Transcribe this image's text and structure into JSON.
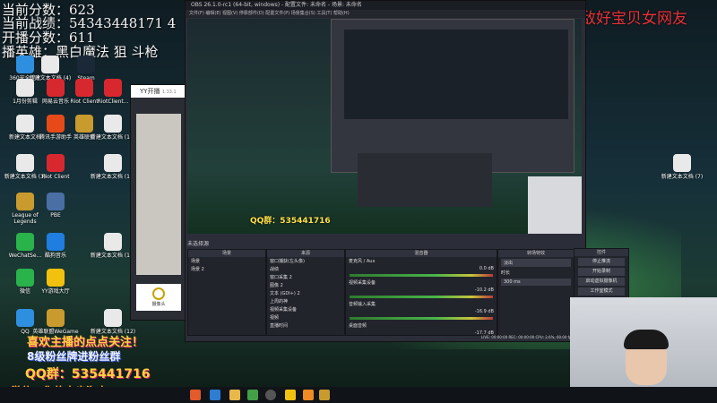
{
  "overlay": {
    "line1": "当前分数：623",
    "line2": "当前战绩：54343448171 4",
    "line3": "开播分数：611",
    "line4": "播英雄：黑白魔法 狙 斗枪"
  },
  "stream_title": "上周的神：宇宙无敌好宝贝女网友",
  "desktop_icons": [
    {
      "label": "360安全卫士",
      "color": "#2e8fe0"
    },
    {
      "label": "新建文本文档 (4)",
      "color": "#e9e9e9"
    },
    {
      "label": "Steam",
      "color": "#1b2838"
    },
    {
      "label": "1月份剪辑",
      "color": "#e9e9e9"
    },
    {
      "label": "网易云音乐",
      "color": "#d8282f"
    },
    {
      "label": "Riot Client",
      "color": "#d8282f"
    },
    {
      "label": "RiotClient...",
      "color": "#d8282f"
    },
    {
      "label": "新建文本文档",
      "color": "#e9e9e9"
    },
    {
      "label": "腾讯手游助手",
      "color": "#e64a19"
    },
    {
      "label": "英雄联盟",
      "color": "#c99a2e"
    },
    {
      "label": "新建文本文档 (3)",
      "color": "#e9e9e9"
    },
    {
      "label": "Riot Client",
      "color": "#d8282f"
    },
    {
      "label": "新建文本文档 (10)",
      "color": "#e9e9e9"
    },
    {
      "label": "League of Legends",
      "color": "#c99a2e"
    },
    {
      "label": "PBE",
      "color": "#4a6fa5"
    },
    {
      "label": "WeChatSe...",
      "color": "#2ab24b"
    },
    {
      "label": "酷狗音乐",
      "color": "#1f7ee0"
    },
    {
      "label": "新建文本文档 (13)",
      "color": "#e9e9e9"
    },
    {
      "label": "微信",
      "color": "#2ab24b"
    },
    {
      "label": "YY游戏大厅",
      "color": "#f2c10f"
    },
    {
      "label": "QQ",
      "color": "#2e8fe0"
    },
    {
      "label": "英雄联盟WeGame",
      "color": "#c99a2e"
    },
    {
      "label": "新建文本文档 (12)",
      "color": "#e9e9e9"
    },
    {
      "label": "新建文本文档 (11)",
      "color": "#e9e9e9"
    },
    {
      "label": "新建文本文档 (7)",
      "color": "#e9e9e9"
    }
  ],
  "yy_window": {
    "title": "YY开播",
    "version": "1.33.1",
    "button": "摄像头"
  },
  "obs": {
    "title": "OBS 26.1.0-rc1 (64-bit, windows) - 配置文件: 未命名 - 场景: 未命名",
    "menu": "文件(F)  编辑(E)  视图(V)  停靠部件(D)  配置文件(P)  场景集合(S)  工具(T)  帮助(H)",
    "status_bar": "未选择源",
    "scenes_header": "场景",
    "scenes": [
      "场景",
      "场景 2"
    ],
    "sources_header": "来源",
    "sources": [
      "窗口捕获(左头像)",
      "战绩",
      "窗口采集 2",
      "图像 2",
      "文本 (GDI+) 2",
      "上周的神",
      "视频采集设备",
      "视频",
      "直播时间"
    ],
    "mixer_header": "混音器",
    "mixer": [
      {
        "name": "麦克风 / Aux",
        "db": "0.0 dB"
      },
      {
        "name": "视频采集设备",
        "db": "-10.2 dB"
      },
      {
        "name": "音频输入采集",
        "db": "-16.9 dB"
      },
      {
        "name": "桌面音频",
        "db": "-17.7 dB"
      }
    ],
    "transitions_header": "转场特效",
    "transition": {
      "type": "淡出",
      "duration_label": "时长",
      "duration": "300 ms"
    },
    "controls_header": "控件",
    "controls": [
      "停止推流",
      "开始录制",
      "启动虚拟摄像机",
      "工作室模式",
      "设置"
    ],
    "stats": "LIVE: 00:00:00   REC: 00:00:00   CPU: 2.6%, 60.00 fps   kb/s: 2713"
  },
  "promo": {
    "follow": "喜欢主播的点点关注！",
    "fans": "8级粉丝牌进粉丝群",
    "qq": "QQ群：535441716",
    "shop": "微信：你的末步淘宝"
  },
  "mini_qq": "QQ群：535441716"
}
